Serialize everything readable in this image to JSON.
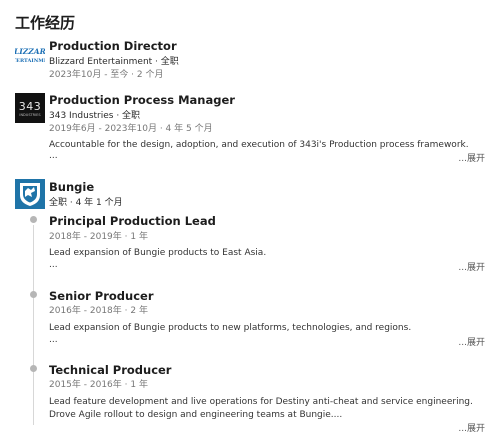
{
  "section": {
    "title": "工作经历"
  },
  "experiences": [
    {
      "logo_icon": "blizzard-logo",
      "logo_text": "BLIZZARD",
      "title": "Production Director",
      "company": "Blizzard Entertainment · 全职",
      "dates": "2023年10月 - 至今 · 2 个月"
    },
    {
      "logo_icon": "343-industries-logo",
      "logo_text": "343",
      "title": "Production Process Manager",
      "company": "343 Industries · 全职",
      "dates": "2019年6月 - 2023年10月 · 4 年 5 个月",
      "description": "Accountable for the design, adoption, and execution of 343i's Production process framework.",
      "ellipsis": "...",
      "expand": "...展开"
    },
    {
      "logo_icon": "bungie-logo",
      "company": "Bungie",
      "summary": "全职 · 4 年 1 个月",
      "roles": [
        {
          "title": "Principal Production Lead",
          "dates": "2018年 - 2019年 · 1 年",
          "description": "Lead expansion of Bungie products to East Asia.",
          "ellipsis": "...",
          "expand": "...展开"
        },
        {
          "title": "Senior Producer",
          "dates": "2016年 - 2018年 · 2 年",
          "description": "Lead expansion of Bungie products to new platforms, technologies, and regions.",
          "ellipsis": "...",
          "expand": "...展开"
        },
        {
          "title": "Technical Producer",
          "dates": "2015年 - 2016年 · 1 年",
          "description_1": "Lead feature development and live operations for Destiny anti-cheat and service engineering.",
          "description_2": "Drove Agile rollout to design and engineering teams at Bungie....",
          "expand": "...展开"
        }
      ]
    }
  ],
  "colors": {
    "bungie_blue": "#1f74a8",
    "logo_343_bg": "#111111",
    "blizzard_blue": "#1b6fb5"
  }
}
